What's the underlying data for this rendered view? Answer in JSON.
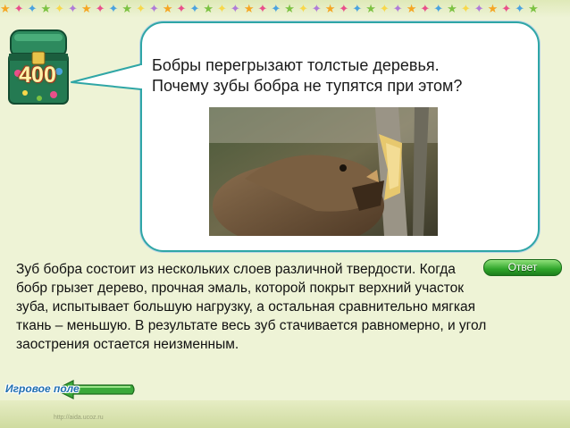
{
  "header": {
    "star_colors": [
      "#f5a623",
      "#e94f8a",
      "#4aa3df",
      "#7cc242",
      "#f7d84a",
      "#b07cd8"
    ]
  },
  "score_tile": {
    "value": "400"
  },
  "question": {
    "line1": "Бобры перегрызают толстые деревья.",
    "line2": "Почему зубы бобра не тупятся при этом?"
  },
  "answer": {
    "text": "Зуб бобра состоит из нескольких слоев различной твердости. Когда бобр грызет дерево, прочная эмаль, которой покрыт верхний участок зуба, испытывает большую нагрузку, а остальная сравнительно мягкая ткань – меньшую. В результате весь зуб стачивается равномерно, и угол заострения остается неизменным."
  },
  "buttons": {
    "answer_label": "Ответ",
    "back_label": "Игровое поле"
  },
  "footer": {
    "url": "http://aida.ucoz.ru"
  },
  "colors": {
    "bubble_border": "#2fa6a6",
    "answer_button": "#2fa52a",
    "back_arrow": "#3aa83a"
  }
}
